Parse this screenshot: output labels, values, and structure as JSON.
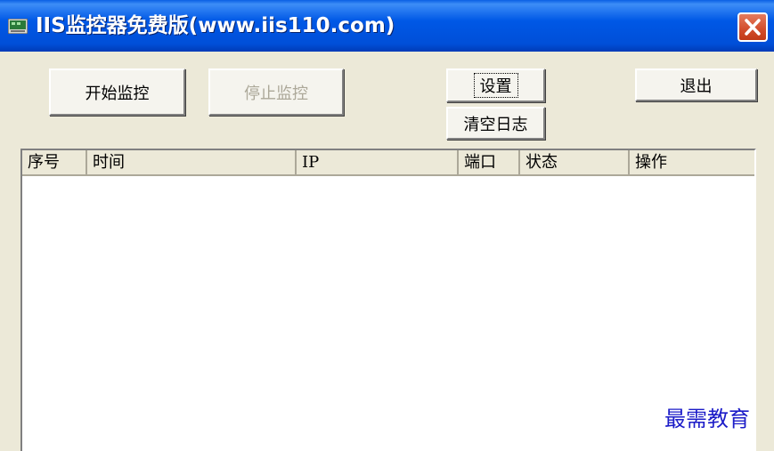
{
  "window": {
    "title": "IIS监控器免费版(www.iis110.com)"
  },
  "buttons": {
    "start": "开始监控",
    "stop": "停止监控",
    "settings": "设置",
    "clear_log": "清空日志",
    "exit": "退出"
  },
  "table": {
    "columns": [
      "序号",
      "时间",
      "IP",
      "端口",
      "状态",
      "操作"
    ],
    "rows": []
  },
  "watermark": "最需教育",
  "colors": {
    "titlebar": "#0058e6",
    "close": "#d24c2b",
    "face": "#ece9d8",
    "watermark": "#1c1cc8"
  },
  "icons": {
    "app": "monitor-icon",
    "close": "close-icon"
  }
}
